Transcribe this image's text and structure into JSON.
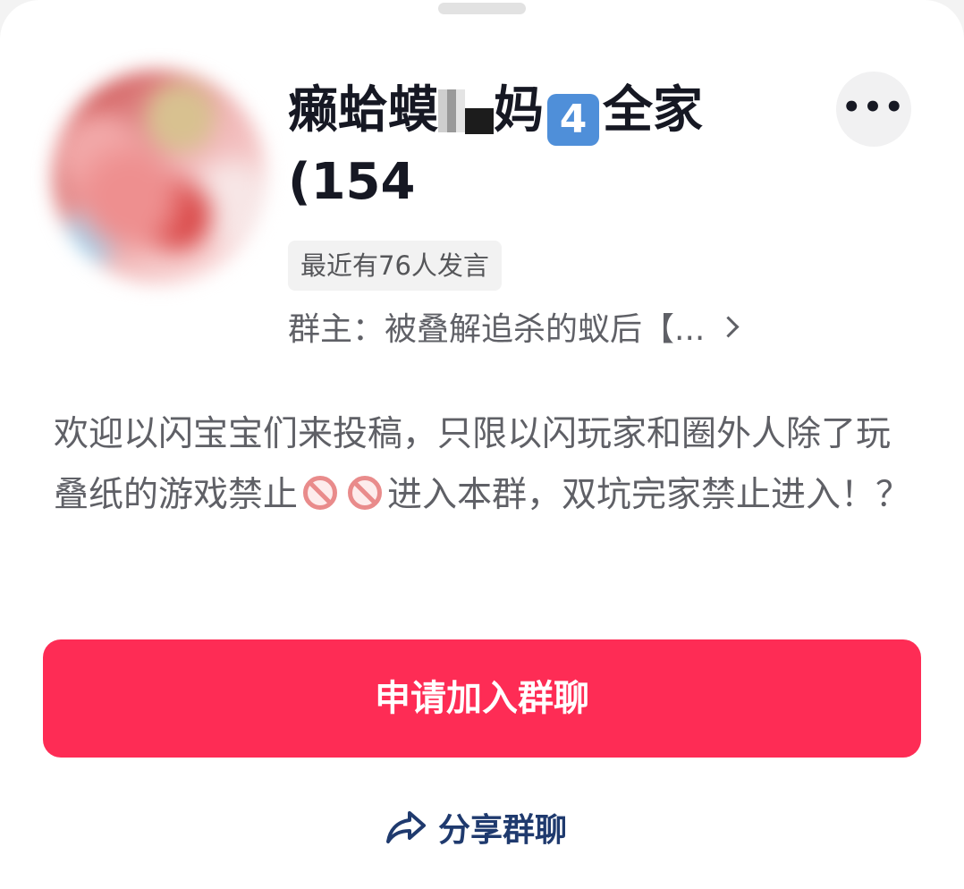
{
  "group": {
    "name_part1": "癞蛤蟆",
    "name_part2": "妈",
    "name_keycap": "4",
    "name_part3": "全家 (154",
    "member_count_note": "",
    "recent_speakers_badge": "最近有76人发言",
    "owner_line": "群主：被叠解追杀的蚁后【...",
    "description_part1": "欢迎以闪宝宝们来投稿，只限以闪玩家和圈外人除了玩叠纸的游戏禁止",
    "description_part2": "进入本群，双坑完家禁止进入！？"
  },
  "actions": {
    "more_label": "•••",
    "join_label": "申请加入群聊",
    "share_label": "分享群聊"
  },
  "icons": {
    "more": "more-dots-icon",
    "owner_chevron": "chevron-right-icon",
    "ban": "prohibited-emoji-icon",
    "keycap": "keycap-4-emoji",
    "share": "share-arrow-icon"
  },
  "colors": {
    "accent": "#fe2c55",
    "share_text": "#1f3a6e",
    "secondary_text": "#5f6066",
    "title_text": "#161823"
  }
}
